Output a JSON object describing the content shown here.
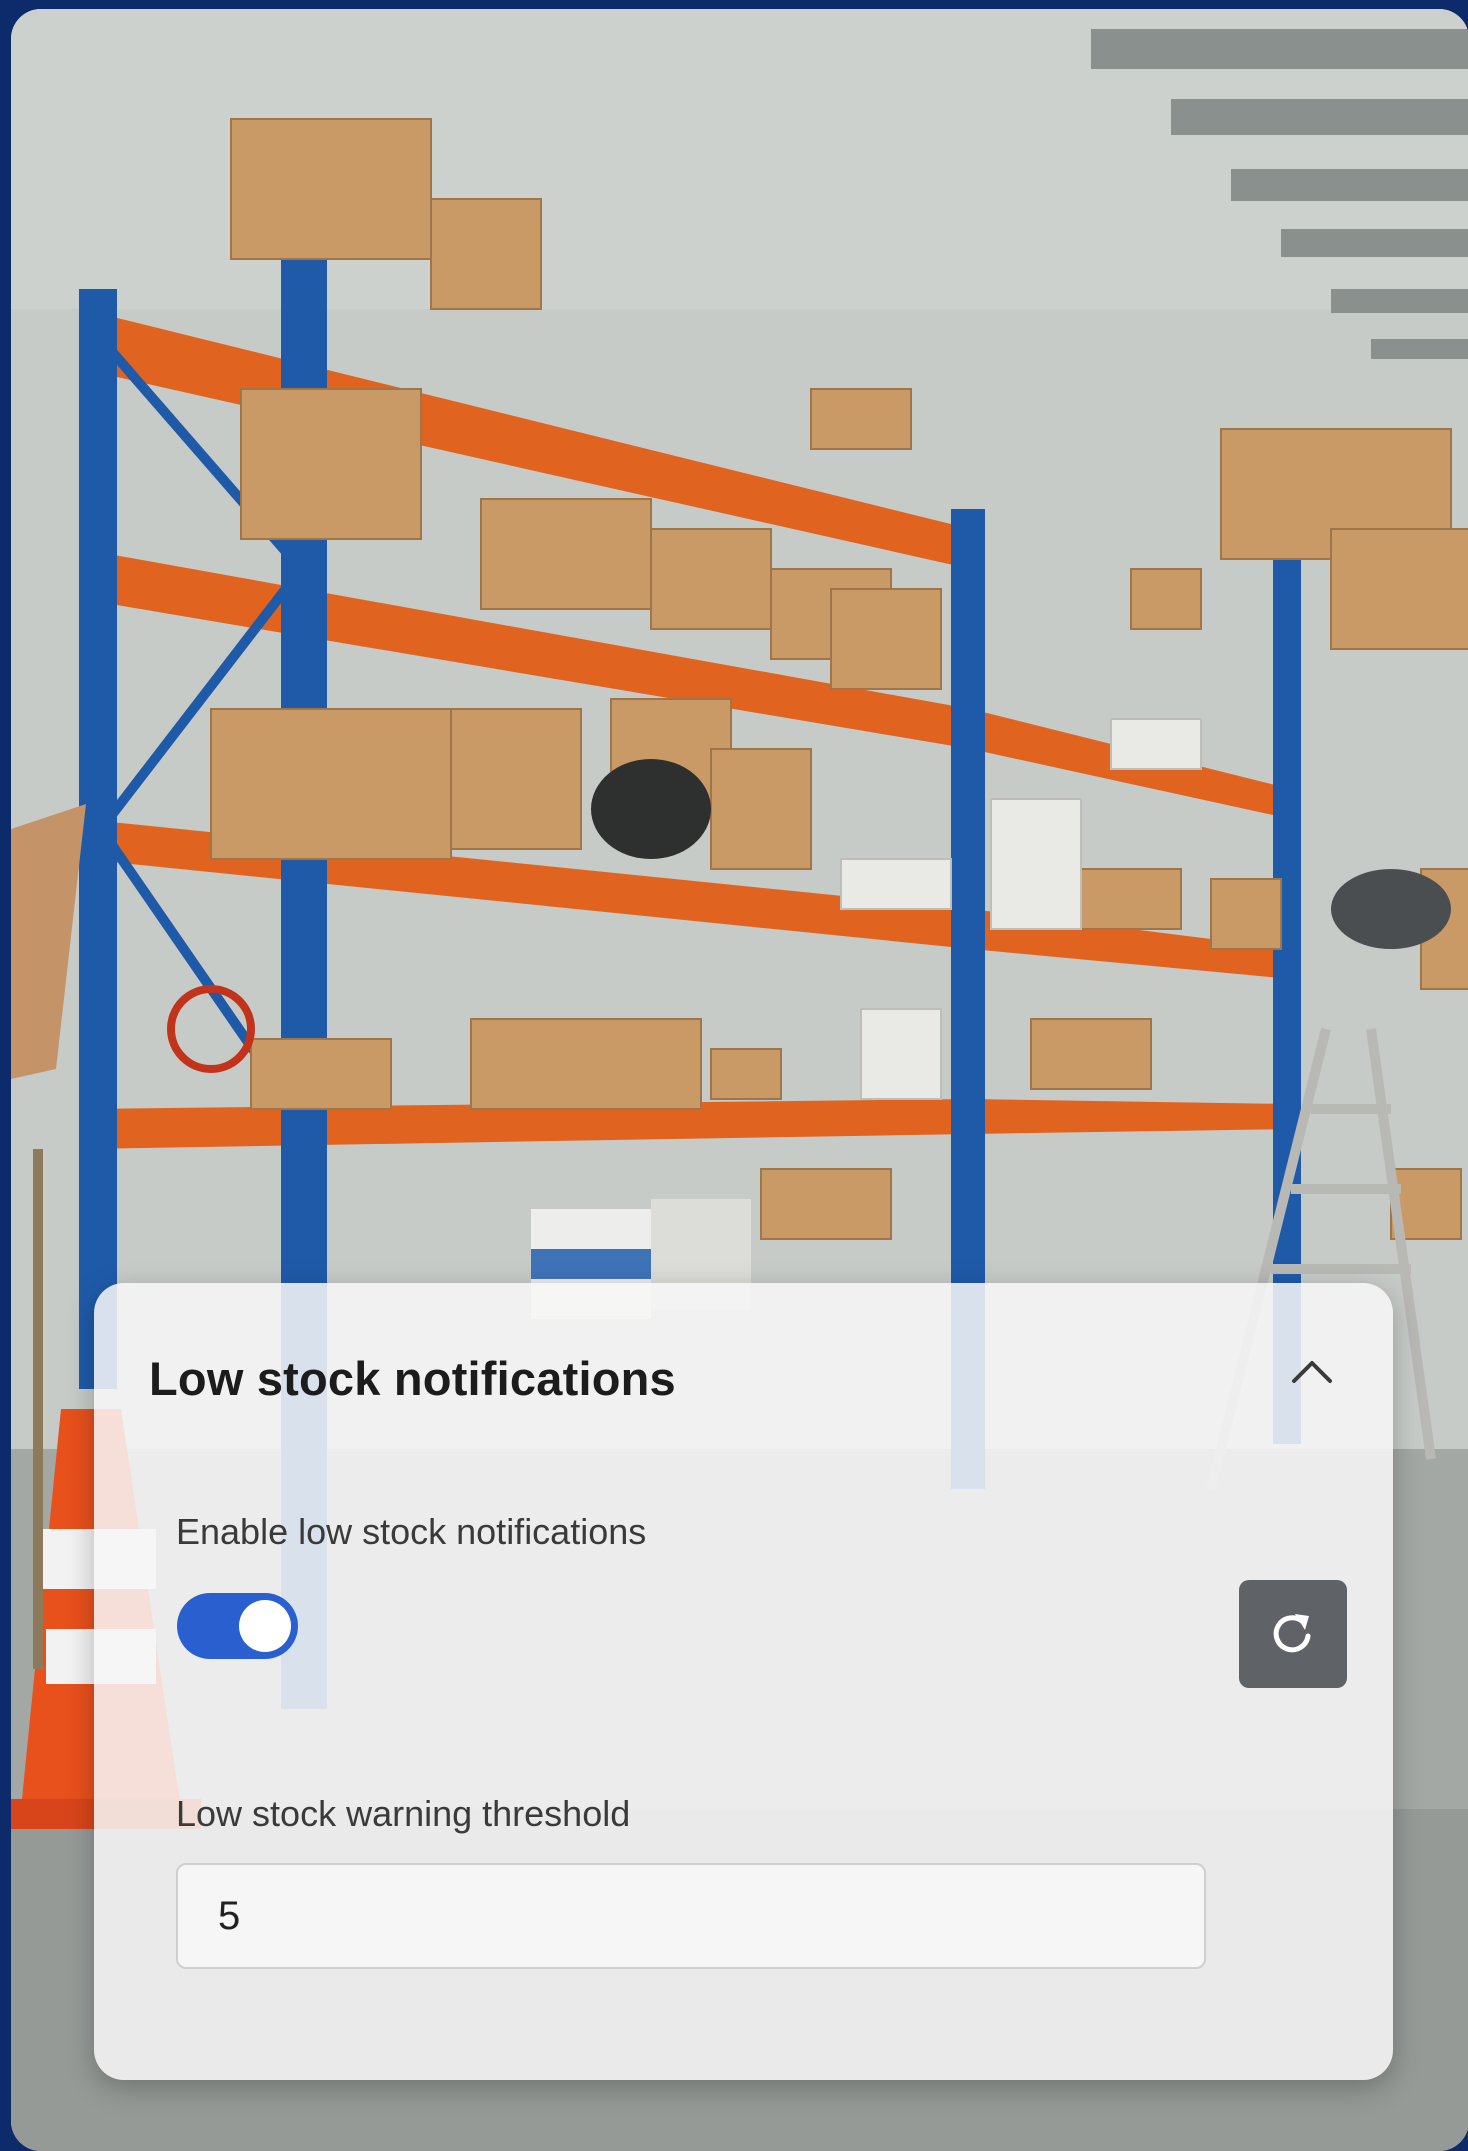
{
  "background": {
    "scene": "warehouse-shelving-photo"
  },
  "card": {
    "title": "Low stock notifications",
    "collapse_icon": "chevron-up-icon",
    "enable_label": "Enable low stock notifications",
    "toggle_on": true,
    "reset_icon": "refresh-icon",
    "threshold_label": "Low stock warning threshold",
    "threshold_value": "5"
  },
  "colors": {
    "page_border": "#0d2b6b",
    "toggle_active": "#2a5fcf",
    "reset_button": "#5f6368",
    "title_text": "#1c1c1c"
  }
}
